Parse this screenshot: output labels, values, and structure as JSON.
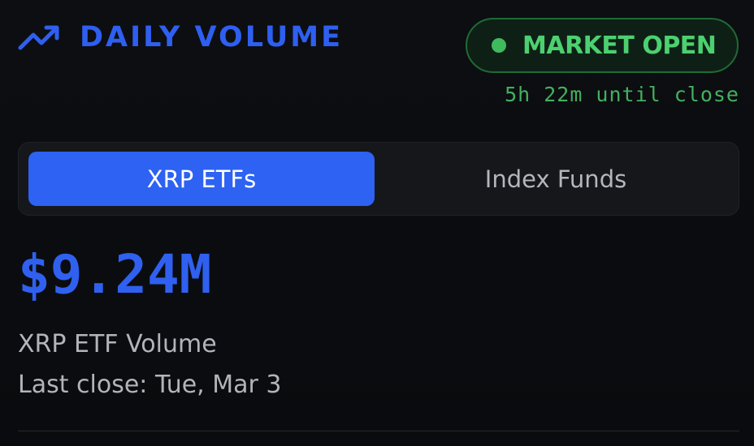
{
  "header": {
    "icon": "trending-up-icon",
    "title": "DAILY VOLUME"
  },
  "status": {
    "label": "MARKET OPEN",
    "countdown": "5h 22m until close"
  },
  "tabs": [
    {
      "label": "XRP ETFs",
      "active": true
    },
    {
      "label": "Index Funds",
      "active": false
    }
  ],
  "summary": {
    "value": "$9.24M",
    "label": "XRP ETF Volume",
    "last_close": "Last close: Tue, Mar 3"
  },
  "colors": {
    "accent": "#2f5ff0",
    "status_green": "#4cd070",
    "background": "#0b0c10"
  }
}
